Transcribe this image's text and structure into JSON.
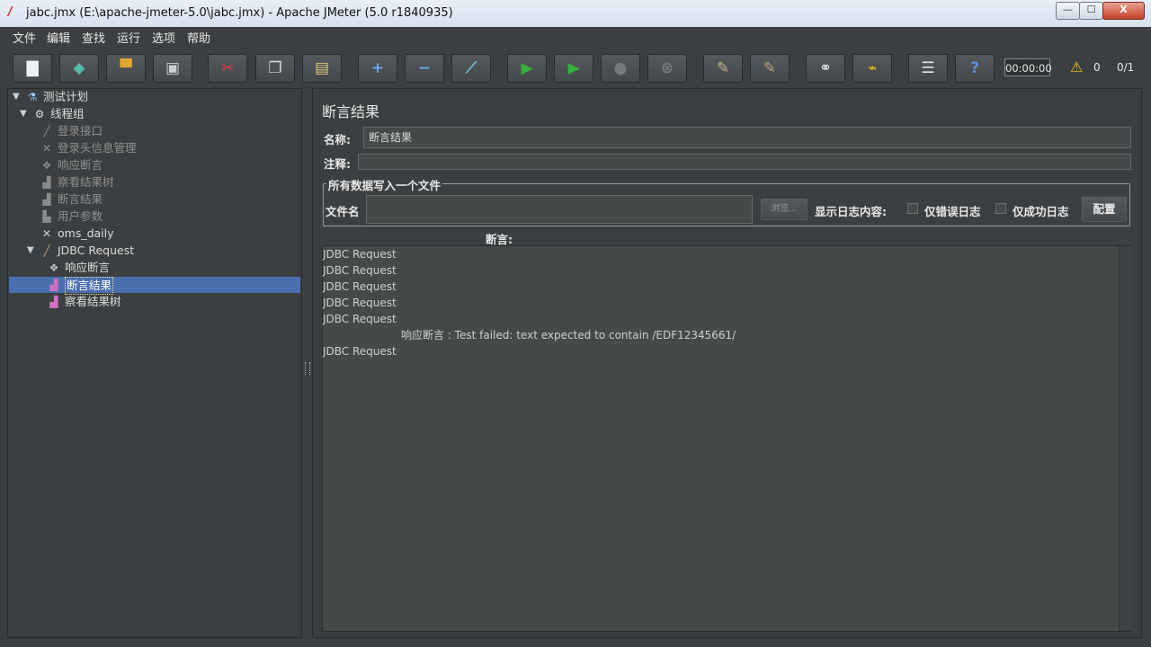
{
  "window": {
    "title": "jabc.jmx (E:\\apache-jmeter-5.0\\jabc.jmx) - Apache JMeter (5.0 r1840935)",
    "minimize": "—",
    "maximize": "☐",
    "close": "X"
  },
  "menu": [
    "文件",
    "编辑",
    "查找",
    "运行",
    "选项",
    "帮助"
  ],
  "toolbar": {
    "buttons": [
      {
        "icon": "new-icon",
        "glyph": "▇",
        "color": "#f0f0f0"
      },
      {
        "icon": "templates-icon",
        "glyph": "◆",
        "color": "#59b9a8"
      },
      {
        "icon": "open-icon",
        "glyph": "▀",
        "color": "#e0a832"
      },
      {
        "icon": "save-icon",
        "glyph": "▣",
        "color": "#cfcfcf"
      },
      {
        "icon": "cut-icon",
        "glyph": "✂",
        "color": "#e04040"
      },
      {
        "icon": "copy-icon",
        "glyph": "❐",
        "color": "#d8d8d8"
      },
      {
        "icon": "paste-icon",
        "glyph": "▤",
        "color": "#e0c87a"
      },
      {
        "icon": "expand-icon",
        "glyph": "+",
        "color": "#6aa7e8"
      },
      {
        "icon": "collapse-icon",
        "glyph": "−",
        "color": "#6aa7e8"
      },
      {
        "icon": "toggle-icon",
        "glyph": "⟋",
        "color": "#7fbde0"
      },
      {
        "icon": "start-icon",
        "glyph": "▶",
        "color": "#35b040"
      },
      {
        "icon": "start-no-pauses-icon",
        "glyph": "▶",
        "color": "#35b040"
      },
      {
        "icon": "stop-icon",
        "glyph": "●",
        "color": "#7a7a7a"
      },
      {
        "icon": "shutdown-icon",
        "glyph": "⊗",
        "color": "#7a7a7a"
      },
      {
        "icon": "clear-icon",
        "glyph": "✎",
        "color": "#c8b090"
      },
      {
        "icon": "clear-all-icon",
        "glyph": "✎",
        "color": "#b8a080"
      },
      {
        "icon": "search-icon",
        "glyph": "⚭",
        "color": "#e0e0e0"
      },
      {
        "icon": "reset-search-icon",
        "glyph": "⌁",
        "color": "#f0c020"
      },
      {
        "icon": "function-helper-icon",
        "glyph": "☰",
        "color": "#e0e0e0"
      },
      {
        "icon": "help-icon",
        "glyph": "?",
        "color": "#5b8fe0"
      }
    ],
    "timer": "00:00:00",
    "warnings": "0",
    "threads": "0/1"
  },
  "tree": [
    {
      "label": "测试计划",
      "icon": "test-plan-icon",
      "glyph": "⚗",
      "state": "enabled",
      "arrow": "▼"
    },
    {
      "label": "线程组",
      "icon": "thread-group-icon",
      "glyph": "⚙",
      "state": "enabled",
      "arrow": "▼"
    },
    {
      "label": "登录接口",
      "icon": "sampler-icon",
      "glyph": "╱",
      "state": "disabled",
      "arrow": ""
    },
    {
      "label": "登录头信息管理",
      "icon": "config-icon",
      "glyph": "✕",
      "state": "disabled",
      "arrow": ""
    },
    {
      "label": "响应断言",
      "icon": "assertion-icon",
      "glyph": "❖",
      "state": "disabled",
      "arrow": ""
    },
    {
      "label": "察看结果树",
      "icon": "listener-icon",
      "glyph": "▟",
      "state": "disabled",
      "arrow": ""
    },
    {
      "label": "断言结果",
      "icon": "listener-icon",
      "glyph": "▟",
      "state": "disabled",
      "arrow": ""
    },
    {
      "label": "用户参数",
      "icon": "preprocessor-icon",
      "glyph": "▙",
      "state": "disabled",
      "arrow": ""
    },
    {
      "label": "oms_daily",
      "icon": "config-icon",
      "glyph": "✕",
      "state": "enabled",
      "arrow": ""
    },
    {
      "label": "JDBC Request",
      "icon": "sampler-icon",
      "glyph": "╱",
      "state": "enabled",
      "arrow": "▼"
    },
    {
      "label": "响应断言",
      "icon": "assertion-icon",
      "glyph": "❖",
      "state": "enabled",
      "arrow": ""
    },
    {
      "label": "断言结果",
      "icon": "listener-icon",
      "glyph": "▟",
      "state": "selected",
      "arrow": ""
    },
    {
      "label": "察看结果树",
      "icon": "listener-icon",
      "glyph": "▟",
      "state": "enabled",
      "arrow": ""
    }
  ],
  "panel": {
    "title": "断言结果",
    "name_label": "名称:",
    "name_value": "断言结果",
    "comment_label": "注释:",
    "comment_value": "",
    "file_group": "所有数据写入一个文件",
    "filename_label": "文件名",
    "filename_value": "",
    "browse_button": "浏览...",
    "log_label": "显示日志内容:",
    "errors_only": "仅错误日志",
    "success_only": "仅成功日志",
    "configure_button": "配置",
    "assertion_header": "断言:"
  },
  "results": [
    {
      "text": "JDBC Request",
      "indent": false
    },
    {
      "text": "JDBC Request",
      "indent": false
    },
    {
      "text": "JDBC Request",
      "indent": false
    },
    {
      "text": "JDBC Request",
      "indent": false
    },
    {
      "text": "JDBC Request",
      "indent": false
    },
    {
      "text": "响应断言 : Test failed: text expected to contain /EDF12345661/",
      "indent": true
    },
    {
      "text": "JDBC Request",
      "indent": false
    }
  ]
}
